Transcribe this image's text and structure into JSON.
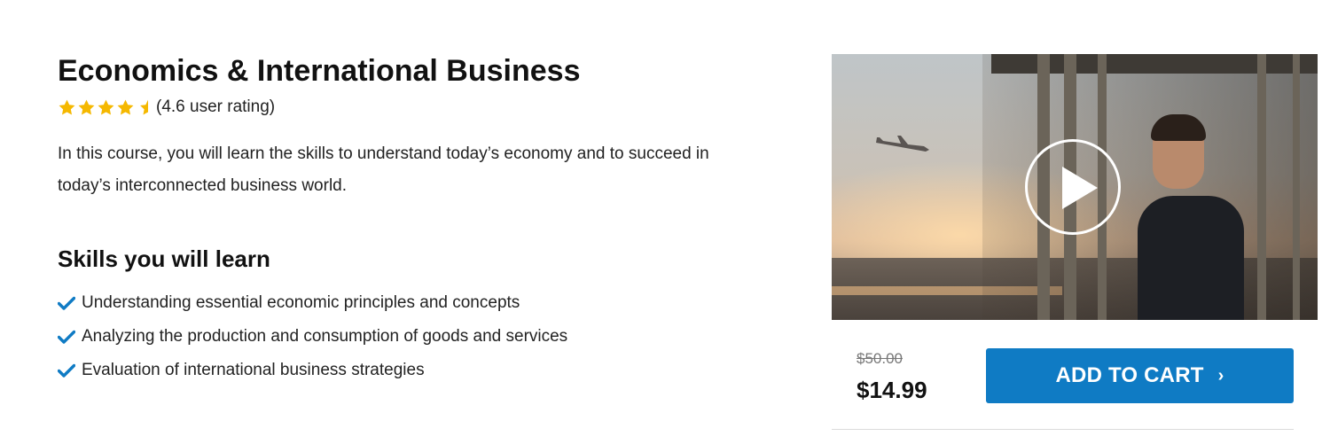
{
  "course": {
    "title": "Economics & International Business",
    "rating_text": "(4.6 user rating)",
    "rating_value": 4.6,
    "rating_max": 5,
    "star_color": "#f5b800",
    "description": "In this course, you will learn the skills to understand today’s economy and to succeed in today’s interconnected business world."
  },
  "skills": {
    "heading": "Skills you will learn",
    "check_color": "#0f7bc4",
    "items": [
      "Understanding essential economic principles and concepts",
      "Analyzing the production and consumption of goods and services",
      "Evaluation of international business strategies"
    ]
  },
  "purchase": {
    "original_price": "$50.00",
    "price": "$14.99",
    "cart_label": "ADD TO CART",
    "cart_icon": "chevron-right-icon",
    "accent": "#0f7bc4"
  },
  "video": {
    "play_icon": "play-icon"
  }
}
